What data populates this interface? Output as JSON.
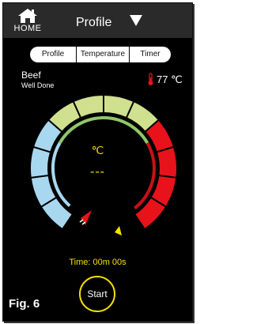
{
  "header": {
    "home_label": "HOME",
    "title": "Profile"
  },
  "tabs": [
    {
      "label": "Profile"
    },
    {
      "label": "Temperature"
    },
    {
      "label": "Timer"
    }
  ],
  "meat": {
    "name": "Beef",
    "doneness": "Well Done"
  },
  "temperature": {
    "value": "77 ℃"
  },
  "gauge": {
    "unit": "℃",
    "value": "---",
    "colors": {
      "cool": "#a8d8ef",
      "warm": "#cfe08f",
      "hot": "#e8131a",
      "inner_ring": "#8fc76a",
      "inner_hot": "#c81018",
      "marker_left": "#e8131a",
      "marker_right": "#f6e000"
    }
  },
  "timer": {
    "text": "Time: 00m 00s"
  },
  "start_button": {
    "label": "Start"
  },
  "caption": "Fig. 6"
}
